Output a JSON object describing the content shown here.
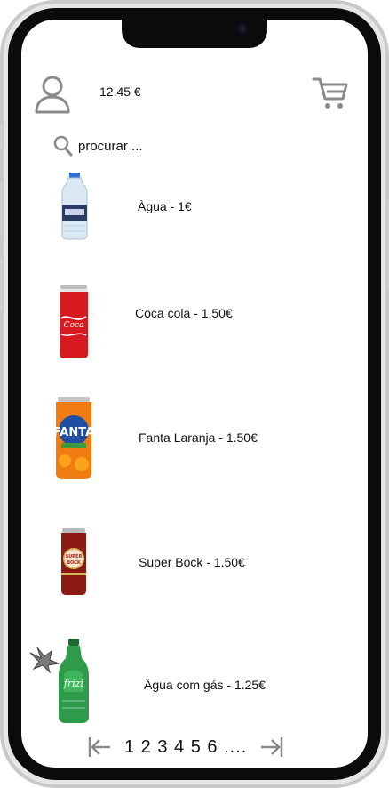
{
  "header": {
    "balance": "12.45 €",
    "user_icon": "user-icon",
    "cart_icon": "cart-icon"
  },
  "search": {
    "placeholder": "procurar ...",
    "icon": "search-icon"
  },
  "products": [
    {
      "label": "Àgua - 1€",
      "image": "water-bottle"
    },
    {
      "label": "Coca cola - 1.50€",
      "image": "coca-cola-can"
    },
    {
      "label": "Fanta Laranja - 1.50€",
      "image": "fanta-can"
    },
    {
      "label": "Super Bock - 1.50€",
      "image": "super-bock-can"
    },
    {
      "label": "Àgua com gás - 1.25€",
      "image": "frize-bottle"
    }
  ],
  "pagination": {
    "pages": "1 2 3 4 5 6 ....",
    "prev_icon": "first-page-icon",
    "next_icon": "last-page-icon"
  }
}
